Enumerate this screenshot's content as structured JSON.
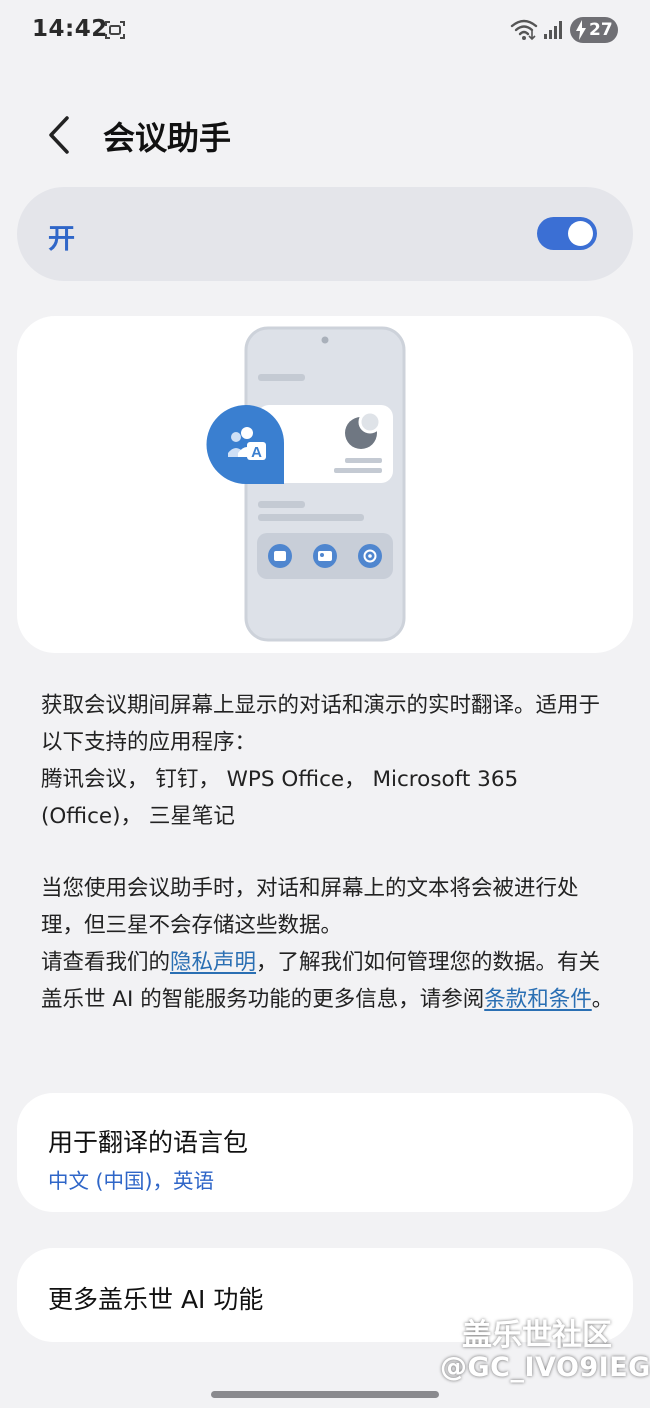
{
  "status_bar": {
    "time": "14:42",
    "battery": "27",
    "icons": [
      "screen-recorder-icon",
      "wifi-icon",
      "signal-icon",
      "charging-bolt-icon"
    ]
  },
  "header": {
    "title": "会议助手",
    "back_icon": "chevron-left-icon"
  },
  "toggle": {
    "label": "开",
    "state": "on",
    "accent": "#3b6fd4"
  },
  "illustration": {
    "icons": [
      "people-translate-icon",
      "profile-circle-icon",
      "meeting-app-icon",
      "contact-card-icon",
      "sync-icon"
    ]
  },
  "description": {
    "p1": "获取会议期间屏幕上显示的对话和演示的实时翻译。适用于以下支持的应用程序：",
    "apps": "腾讯会议， 钉钉， WPS Office， Microsoft 365 (Office)， 三星笔记",
    "p2": "当您使用会议助手时，对话和屏幕上的文本将会被进行处理，但三星不会存储这些数据。",
    "p3_before": "请查看我们的",
    "privacy_link": "隐私声明",
    "p3_middle": "，了解我们如何管理您的数据。有关盖乐世 AI 的智能服务功能的更多信息，请参阅",
    "terms_link": "条款和条件",
    "p3_after": "。"
  },
  "language_pack": {
    "title": "用于翻译的语言包",
    "value": "中文 (中国)，英语"
  },
  "more": {
    "title": "更多盖乐世 AI 功能"
  },
  "watermark": {
    "brand": "盖乐世社区",
    "user": "@GC_IVO9IEG"
  },
  "colors": {
    "background": "#f2f2f4",
    "card": "#ffffff",
    "link": "#2a6fb3",
    "blue_accent": "#2f66c8"
  }
}
